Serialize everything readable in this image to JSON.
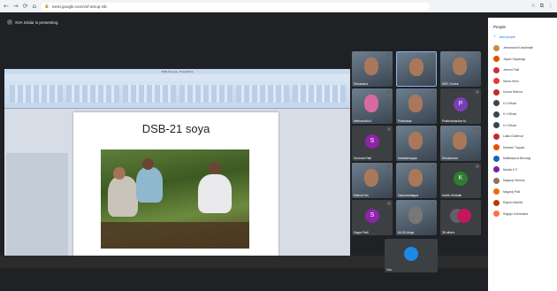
{
  "browser": {
    "url": "meet.google.com/xnf-amup-ctb"
  },
  "meet": {
    "presenting_text": "SVA Sridar is presenting",
    "presentation": {
      "window_title": "DSB-21 soya - PowerPoint",
      "slide_title": "DSB-21 soya"
    },
    "tiles": [
      {
        "name": "Shivanand",
        "type": "photo"
      },
      {
        "name": "",
        "type": "photo"
      },
      {
        "name": "NRC Guntur",
        "type": "photo"
      },
      {
        "name": "Nethravathi A",
        "type": "photo"
      },
      {
        "name": "Prabhakar",
        "type": "photo"
      },
      {
        "name": "Prabhushankar M",
        "type": "letter",
        "letter": "P",
        "color": "#7b3fb5"
      },
      {
        "name": "Sushma Patil",
        "type": "letter",
        "letter": "S",
        "color": "#8e24aa"
      },
      {
        "name": "Mahadevappa",
        "type": "photo"
      },
      {
        "name": "Shivakumar",
        "type": "photo"
      },
      {
        "name": "Rathod Mn",
        "type": "photo"
      },
      {
        "name": "Hanumantappa",
        "type": "photo"
      },
      {
        "name": "Kartik Hebbalk",
        "type": "letter",
        "letter": "K",
        "color": "#2e7d32"
      },
      {
        "name": "Sagar Patil",
        "type": "letter",
        "letter": "S",
        "color": "#8e24aa"
      },
      {
        "name": "KA 28 drugs",
        "type": "photo"
      },
      {
        "name": "38 others",
        "type": "others"
      },
      {
        "name": "You",
        "type": "self"
      }
    ],
    "people_panel": {
      "title": "People",
      "add_people": "Add people",
      "participants": [
        {
          "name": "Jeevanand Kowdimath",
          "color": "#c98a4b"
        },
        {
          "name": "Jayalx Hipparagi",
          "color": "#e65100"
        },
        {
          "name": "Jeevini Patil",
          "color": "#d32f2f"
        },
        {
          "name": "Nisha Hiren",
          "color": "#e53935"
        },
        {
          "name": "Kumar Rathod",
          "color": "#c62828"
        },
        {
          "name": "K.H.Bhusi",
          "color": "#37474f"
        },
        {
          "name": "K.H.Bhusi",
          "color": "#37474f"
        },
        {
          "name": "K.H.Bhusi",
          "color": "#37474f"
        },
        {
          "name": "Lalita Chaftrval",
          "color": "#c62828"
        },
        {
          "name": "Mahesh Tuppad",
          "color": "#e65100"
        },
        {
          "name": "Mallikarjuna Bhusagi",
          "color": "#1565c0"
        },
        {
          "name": "Manila K S",
          "color": "#7b1fa2"
        },
        {
          "name": "Nagaraj Hanima",
          "color": "#8d6e63"
        },
        {
          "name": "Nagaraj Patil",
          "color": "#ef6c00"
        },
        {
          "name": "Rajesh Mahilot",
          "color": "#bf360c"
        },
        {
          "name": "Ragaju Subramani",
          "color": "#ff7043"
        }
      ]
    }
  }
}
